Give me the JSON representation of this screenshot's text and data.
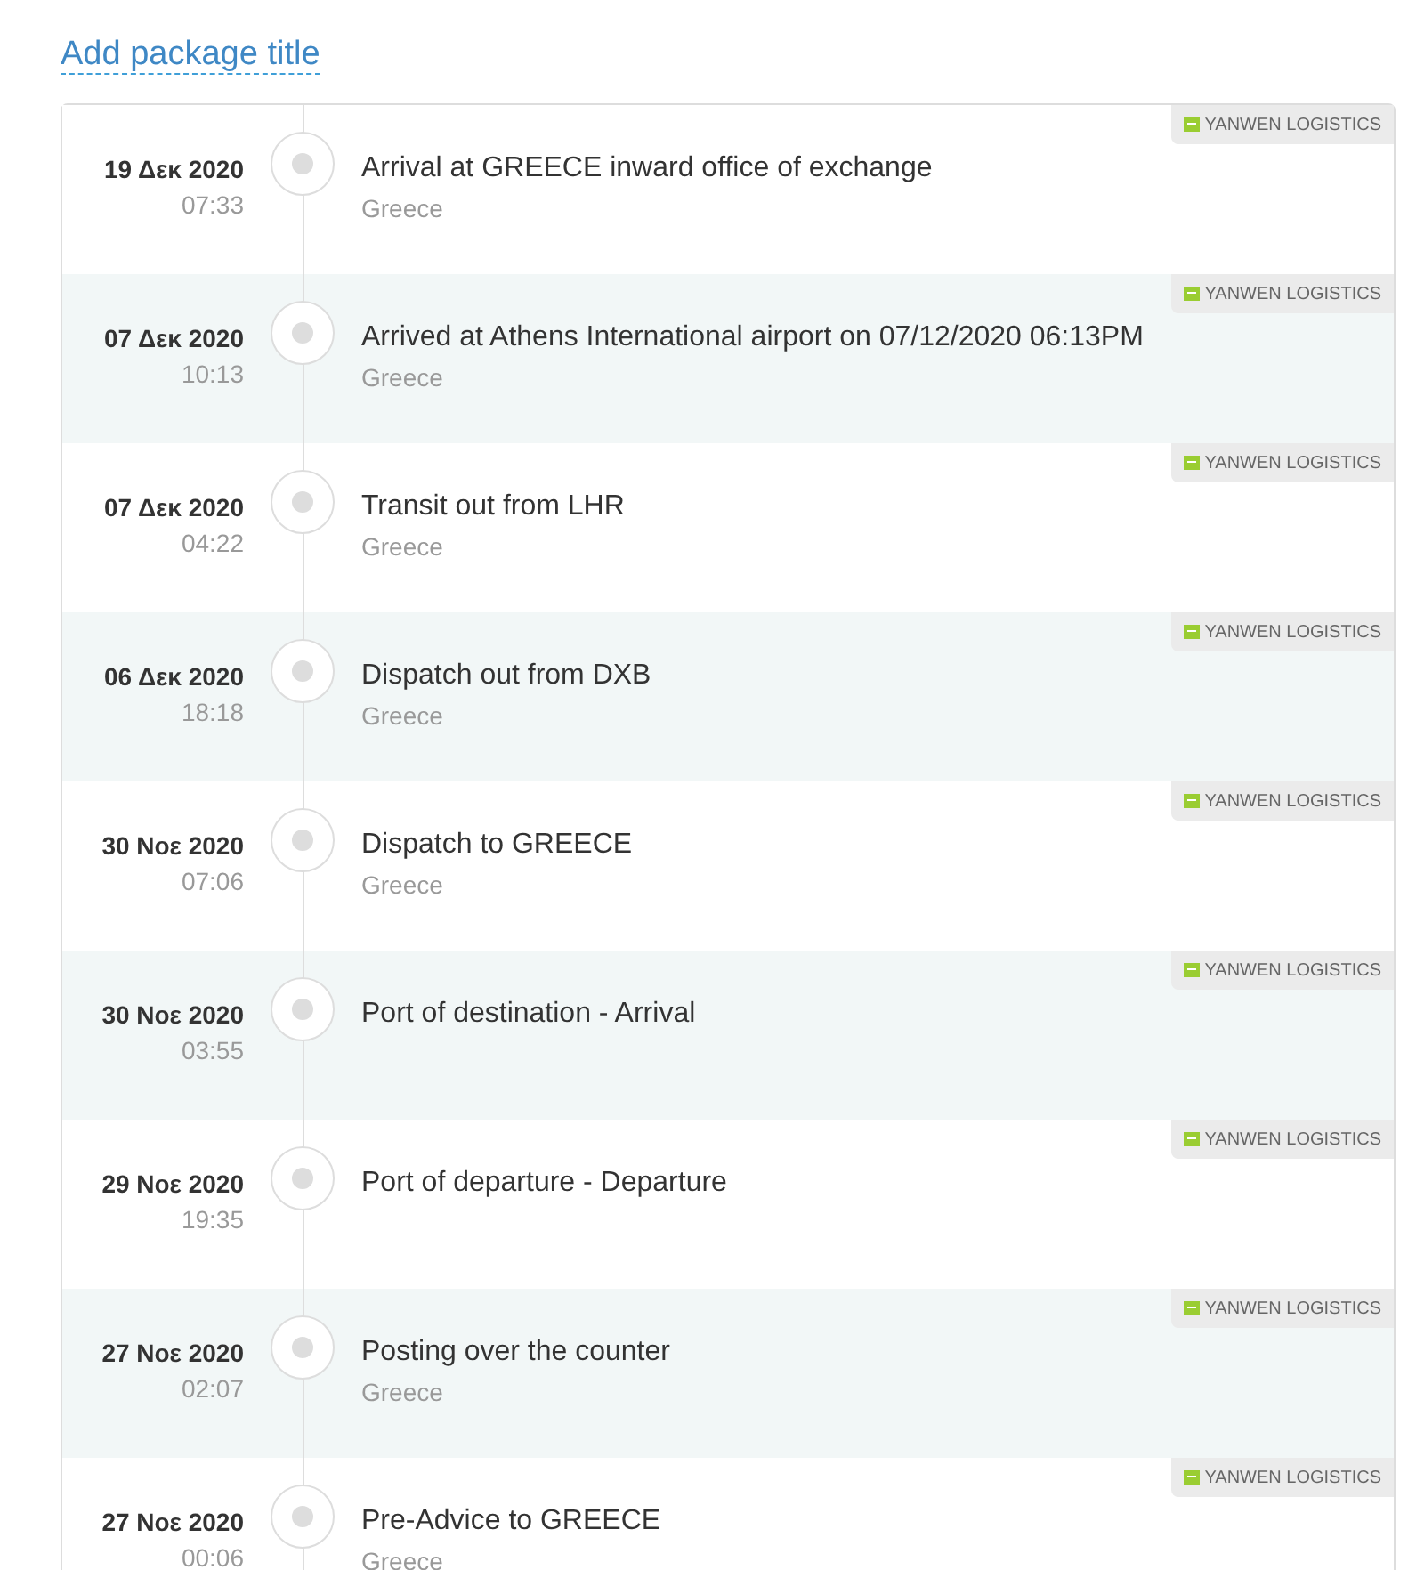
{
  "title_link": "Add package title",
  "events": [
    {
      "date": "19 Δεκ 2020",
      "time": "07:33",
      "status": "Arrival at GREECE inward office of exchange",
      "location": "Greece",
      "carrier": "YANWEN LOGISTICS"
    },
    {
      "date": "07 Δεκ 2020",
      "time": "10:13",
      "status": "Arrived at Athens International airport on 07/12/2020 06:13PM",
      "location": "Greece",
      "carrier": "YANWEN LOGISTICS"
    },
    {
      "date": "07 Δεκ 2020",
      "time": "04:22",
      "status": "Transit out from LHR",
      "location": "Greece",
      "carrier": "YANWEN LOGISTICS"
    },
    {
      "date": "06 Δεκ 2020",
      "time": "18:18",
      "status": "Dispatch out from DXB",
      "location": "Greece",
      "carrier": "YANWEN LOGISTICS"
    },
    {
      "date": "30 Νοε 2020",
      "time": "07:06",
      "status": "Dispatch to GREECE",
      "location": "Greece",
      "carrier": "YANWEN LOGISTICS"
    },
    {
      "date": "30 Νοε 2020",
      "time": "03:55",
      "status": "Port of destination - Arrival",
      "carrier": "YANWEN LOGISTICS"
    },
    {
      "date": "29 Νοε 2020",
      "time": "19:35",
      "status": "Port of departure - Departure",
      "carrier": "YANWEN LOGISTICS"
    },
    {
      "date": "27 Νοε 2020",
      "time": "02:07",
      "status": "Posting over the counter",
      "location": "Greece",
      "carrier": "YANWEN LOGISTICS"
    },
    {
      "date": "27 Νοε 2020",
      "time": "00:06",
      "status": "Pre-Advice to GREECE",
      "location": "Greece",
      "carrier": "YANWEN LOGISTICS"
    }
  ]
}
